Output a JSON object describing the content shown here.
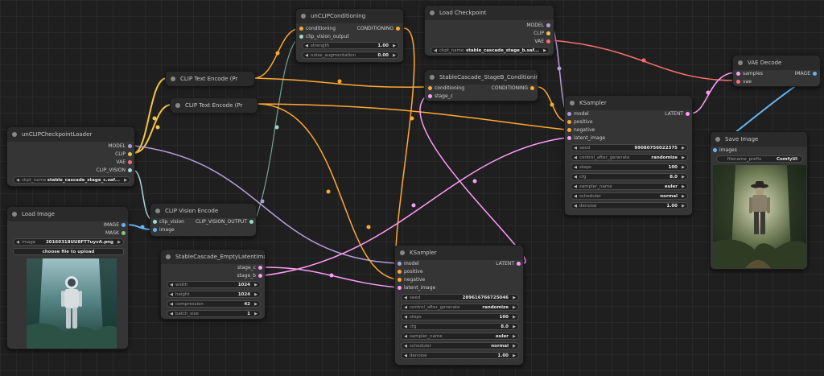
{
  "colors": {
    "model": "#b39ddb",
    "clip": "#f5c542",
    "vae": "#ff6e6e",
    "clip_vision": "#a8dadc",
    "clip_vision_output": "#a0d8c8",
    "conditioning": "#ffa931",
    "latent": "#ff9cf9",
    "image": "#64b5f6",
    "mask": "#81c784"
  },
  "nodes": {
    "unclip_conditioning": {
      "title": "unCLIPConditioning",
      "in_conditioning": "conditioning",
      "in_clip_vision_output": "clip_vision_output",
      "out_conditioning": "CONDITIONING",
      "strength_label": "strength",
      "strength_value": "1.00",
      "noise_label": "noise_augmentation",
      "noise_value": "0.00"
    },
    "load_checkpoint": {
      "title": "Load Checkpoint",
      "out_model": "MODEL",
      "out_clip": "CLIP",
      "out_vae": "VAE",
      "ckpt_label": "ckpt_name",
      "ckpt_value": "stable_cascade_stage_b.saf..."
    },
    "vae_decode": {
      "title": "VAE Decode",
      "in_samples": "samples",
      "in_vae": "vae",
      "out_image": "IMAGE"
    },
    "clip_text_encode_1": {
      "title": "CLIP Text Encode (Pr"
    },
    "clip_text_encode_2": {
      "title": "CLIP Text Encode (Pr"
    },
    "stage_b_conditioning": {
      "title": "StableCascade_StageB_Conditioning",
      "in_conditioning": "conditioning",
      "in_stage_c": "stage_c",
      "out_conditioning": "CONDITIONING"
    },
    "ksampler_top": {
      "title": "KSampler",
      "in_model": "model",
      "in_positive": "positive",
      "in_negative": "negative",
      "in_latent": "latent_image",
      "out_latent": "LATENT",
      "widgets": [
        {
          "label": "seed",
          "value": "99080756022375"
        },
        {
          "label": "control_after_generate",
          "value": "randomize"
        },
        {
          "label": "steps",
          "value": "100"
        },
        {
          "label": "cfg",
          "value": "8.0"
        },
        {
          "label": "sampler_name",
          "value": "euler"
        },
        {
          "label": "scheduler",
          "value": "normal"
        },
        {
          "label": "denoise",
          "value": "1.00"
        }
      ]
    },
    "unclip_checkpoint_loader": {
      "title": "unCLIPCheckpointLoader",
      "out_model": "MODEL",
      "out_clip": "CLIP",
      "out_vae": "VAE",
      "out_clip_vision": "CLIP_VISION",
      "ckpt_label": "ckpt_name",
      "ckpt_value": "stable_cascade_stage_c.saf..."
    },
    "save_image": {
      "title": "Save Image",
      "in_images": "images",
      "prefix_label": "filename_prefix",
      "prefix_value": "ComfyUI"
    },
    "clip_vision_encode": {
      "title": "CLIP Vision Encode",
      "in_clip_vision": "clip_vision",
      "in_image": "image",
      "out": "CLIP_VISION_OUTPUT"
    },
    "load_image": {
      "title": "Load Image",
      "out_image": "IMAGE",
      "out_mask": "MASK",
      "image_label": "image",
      "image_value": "20160318UU8FT7uyvA.png",
      "upload_label": "choose file to upload"
    },
    "empty_latent": {
      "title": "StableCascade_EmptyLatentImage",
      "out_stage_c": "stage_c",
      "out_stage_b": "stage_b",
      "widgets": [
        {
          "label": "width",
          "value": "1024"
        },
        {
          "label": "height",
          "value": "1024"
        },
        {
          "label": "compression",
          "value": "42"
        },
        {
          "label": "batch_size",
          "value": "1"
        }
      ]
    },
    "ksampler_bottom": {
      "title": "KSampler",
      "in_model": "model",
      "in_positive": "positive",
      "in_negative": "negative",
      "in_latent": "latent_image",
      "out_latent": "LATENT",
      "widgets": [
        {
          "label": "seed",
          "value": "289616766725046"
        },
        {
          "label": "control_after_generate",
          "value": "randomize"
        },
        {
          "label": "steps",
          "value": "100"
        },
        {
          "label": "cfg",
          "value": "8.0"
        },
        {
          "label": "sampler_name",
          "value": "euler"
        },
        {
          "label": "scheduler",
          "value": "normal"
        },
        {
          "label": "denoise",
          "value": "1.00"
        }
      ]
    }
  }
}
